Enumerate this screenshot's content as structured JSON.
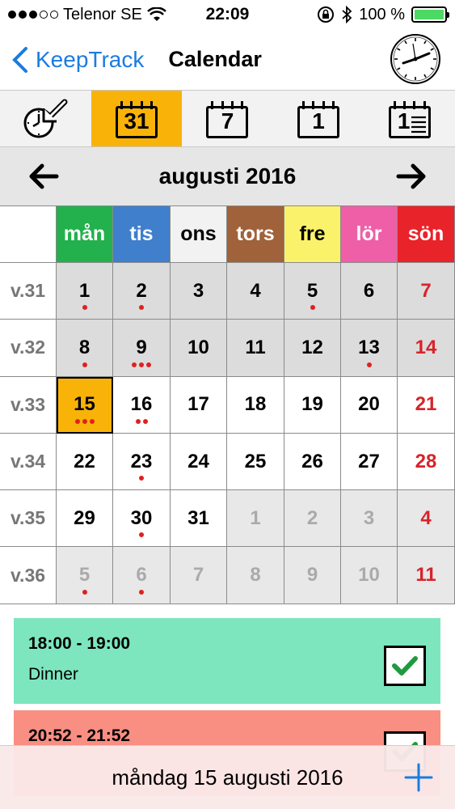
{
  "status_bar": {
    "carrier": "Telenor SE",
    "time": "22:09",
    "battery": "100 %",
    "signal_icon": "signal-dots-icon",
    "wifi_icon": "wifi-icon",
    "lock_icon": "orientation-lock-icon",
    "bluetooth_icon": "bluetooth-icon"
  },
  "nav": {
    "back_label": "KeepTrack",
    "title": "Calendar",
    "clock_icon": "clock-icon"
  },
  "toolbar": {
    "items": [
      {
        "icon": "clock-arrow-icon",
        "label": ""
      },
      {
        "icon": "calendar-month-icon",
        "label": "31",
        "active": true
      },
      {
        "icon": "calendar-week-icon",
        "label": "7"
      },
      {
        "icon": "calendar-day-icon",
        "label": "1"
      },
      {
        "icon": "calendar-list-icon",
        "label": "1"
      }
    ]
  },
  "month": {
    "title": "augusti 2016",
    "prev_icon": "arrow-left-icon",
    "next_icon": "arrow-right-icon"
  },
  "weekdays": [
    {
      "label": "mån",
      "bg": "#22b14c",
      "color": "#ffffff"
    },
    {
      "label": "tis",
      "bg": "#3f7fcc",
      "color": "#ffffff"
    },
    {
      "label": "ons",
      "bg": "#f2f2f2",
      "color": "#000000"
    },
    {
      "label": "tors",
      "bg": "#a0623a",
      "color": "#ffffff"
    },
    {
      "label": "fre",
      "bg": "#fbf26c",
      "color": "#000000"
    },
    {
      "label": "lör",
      "bg": "#ee5fa8",
      "color": "#ffffff"
    },
    {
      "label": "sön",
      "bg": "#e8232a",
      "color": "#ffffff"
    }
  ],
  "weeks": [
    {
      "week": "v.31",
      "days": [
        {
          "d": "1",
          "dots": 1,
          "shaded": true
        },
        {
          "d": "2",
          "dots": 1,
          "shaded": true
        },
        {
          "d": "3",
          "dots": 0,
          "shaded": true
        },
        {
          "d": "4",
          "dots": 0,
          "shaded": true
        },
        {
          "d": "5",
          "dots": 1,
          "shaded": true
        },
        {
          "d": "6",
          "dots": 0,
          "shaded": true
        },
        {
          "d": "7",
          "dots": 0,
          "shaded": true
        }
      ]
    },
    {
      "week": "v.32",
      "days": [
        {
          "d": "8",
          "dots": 1,
          "shaded": true
        },
        {
          "d": "9",
          "dots": 3,
          "shaded": true
        },
        {
          "d": "10",
          "dots": 0,
          "shaded": true
        },
        {
          "d": "11",
          "dots": 0,
          "shaded": true
        },
        {
          "d": "12",
          "dots": 0,
          "shaded": true
        },
        {
          "d": "13",
          "dots": 1,
          "shaded": true
        },
        {
          "d": "14",
          "dots": 0,
          "shaded": true
        }
      ]
    },
    {
      "week": "v.33",
      "days": [
        {
          "d": "15",
          "dots": 3,
          "selected": true
        },
        {
          "d": "16",
          "dots": 2
        },
        {
          "d": "17",
          "dots": 0
        },
        {
          "d": "18",
          "dots": 0
        },
        {
          "d": "19",
          "dots": 0
        },
        {
          "d": "20",
          "dots": 0
        },
        {
          "d": "21",
          "dots": 0
        }
      ]
    },
    {
      "week": "v.34",
      "days": [
        {
          "d": "22",
          "dots": 0
        },
        {
          "d": "23",
          "dots": 1
        },
        {
          "d": "24",
          "dots": 0
        },
        {
          "d": "25",
          "dots": 0
        },
        {
          "d": "26",
          "dots": 0
        },
        {
          "d": "27",
          "dots": 0
        },
        {
          "d": "28",
          "dots": 0
        }
      ]
    },
    {
      "week": "v.35",
      "days": [
        {
          "d": "29",
          "dots": 0
        },
        {
          "d": "30",
          "dots": 1
        },
        {
          "d": "31",
          "dots": 0
        },
        {
          "d": "1",
          "dots": 0,
          "other": true
        },
        {
          "d": "2",
          "dots": 0,
          "other": true
        },
        {
          "d": "3",
          "dots": 0,
          "other": true
        },
        {
          "d": "4",
          "dots": 0,
          "other": true
        }
      ]
    },
    {
      "week": "v.36",
      "days": [
        {
          "d": "5",
          "dots": 1,
          "other": true
        },
        {
          "d": "6",
          "dots": 1,
          "other": true
        },
        {
          "d": "7",
          "dots": 0,
          "other": true
        },
        {
          "d": "8",
          "dots": 0,
          "other": true
        },
        {
          "d": "9",
          "dots": 0,
          "other": true
        },
        {
          "d": "10",
          "dots": 0,
          "other": true
        },
        {
          "d": "11",
          "dots": 0,
          "other": true
        }
      ]
    }
  ],
  "events": [
    {
      "time": "18:00 - 19:00",
      "title": "Dinner",
      "bg": "#7de6be",
      "checked": true
    },
    {
      "time": "20:52 - 21:52",
      "title": "",
      "bg": "#f98e82",
      "checked": true
    }
  ],
  "footer": {
    "selected_date": "måndag 15 augusti 2016",
    "add_icon": "plus-icon"
  },
  "colors": {
    "accent": "#1a7ce0",
    "selected": "#f9b308",
    "sunday": "#d8232a",
    "event_dot": "#e02020"
  }
}
